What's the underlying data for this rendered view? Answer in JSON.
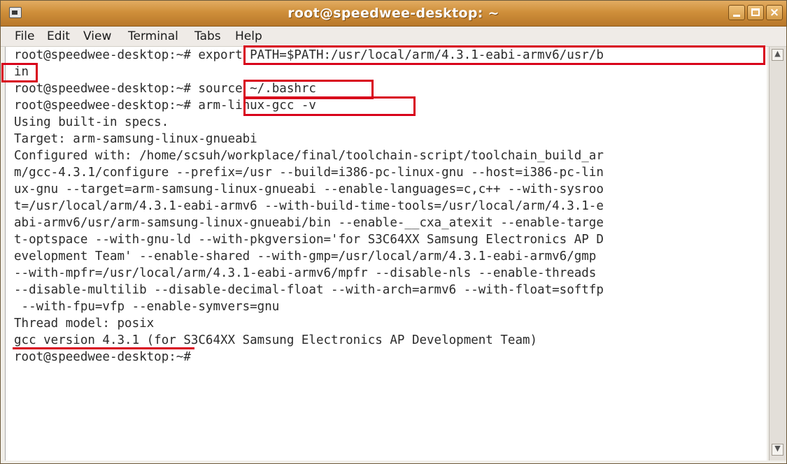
{
  "window": {
    "title": "root@speedwee-desktop: ~"
  },
  "menu": {
    "items": [
      "File",
      "Edit",
      "View",
      "Terminal",
      "Tabs",
      "Help"
    ]
  },
  "terminal": {
    "lines": [
      "root@speedwee-desktop:~# export PATH=$PATH:/usr/local/arm/4.3.1-eabi-armv6/usr/b",
      "in",
      "root@speedwee-desktop:~# source ~/.bashrc",
      "root@speedwee-desktop:~# arm-linux-gcc -v",
      "Using built-in specs.",
      "Target: arm-samsung-linux-gnueabi",
      "Configured with: /home/scsuh/workplace/final/toolchain-script/toolchain_build_ar",
      "m/gcc-4.3.1/configure --prefix=/usr --build=i386-pc-linux-gnu --host=i386-pc-lin",
      "ux-gnu --target=arm-samsung-linux-gnueabi --enable-languages=c,c++ --with-sysroo",
      "t=/usr/local/arm/4.3.1-eabi-armv6 --with-build-time-tools=/usr/local/arm/4.3.1-e",
      "abi-armv6/usr/arm-samsung-linux-gnueabi/bin --enable-__cxa_atexit --enable-targe",
      "t-optspace --with-gnu-ld --with-pkgversion='for S3C64XX Samsung Electronics AP D",
      "evelopment Team' --enable-shared --with-gmp=/usr/local/arm/4.3.1-eabi-armv6/gmp",
      "--with-mpfr=/usr/local/arm/4.3.1-eabi-armv6/mpfr --disable-nls --enable-threads",
      "--disable-multilib --disable-decimal-float --with-arch=armv6 --with-float=softfp",
      " --with-fpu=vfp --enable-symvers=gnu",
      "Thread model: posix",
      "gcc version 4.3.1 (for S3C64XX Samsung Electronics AP Development Team)",
      "root@speedwee-desktop:~#"
    ]
  },
  "colors": {
    "titlebar": "#cf8f3a",
    "highlight": "#d8001a",
    "terminal_bg": "#ffffff",
    "text": "#2b2b2b"
  },
  "icons": {
    "window_icon": "terminal-icon",
    "scroll_up": "arrow-up-icon",
    "scroll_down": "arrow-down-icon"
  }
}
